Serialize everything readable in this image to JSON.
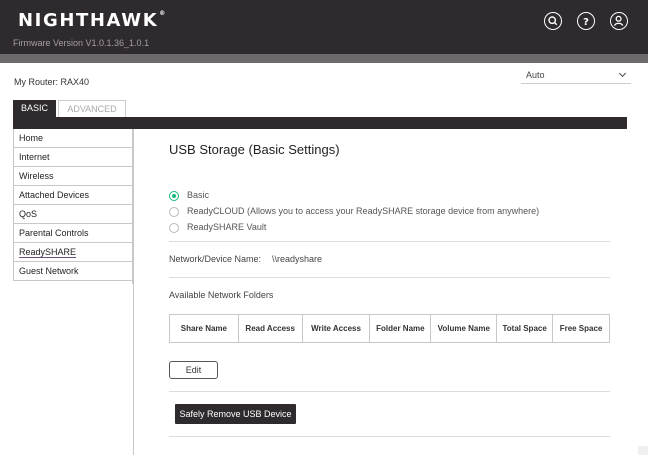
{
  "header": {
    "brand": "NIGHTHAWK",
    "trademark": "®",
    "firmware": "Firmware Version V1.0.1.36_1.0.1",
    "icons": [
      "search-icon",
      "help-icon",
      "user-icon"
    ]
  },
  "router": {
    "label": "My Router: RAX40",
    "language_value": "Auto"
  },
  "tabs": [
    {
      "label": "BASIC",
      "active": true
    },
    {
      "label": "ADVANCED",
      "active": false
    }
  ],
  "sidebar": {
    "items": [
      {
        "label": "Home"
      },
      {
        "label": "Internet"
      },
      {
        "label": "Wireless"
      },
      {
        "label": "Attached Devices"
      },
      {
        "label": "QoS"
      },
      {
        "label": "Parental Controls"
      },
      {
        "label": "ReadySHARE",
        "active": true
      },
      {
        "label": "Guest Network"
      }
    ]
  },
  "main": {
    "title": "USB Storage (Basic Settings)",
    "options": [
      {
        "label": "Basic",
        "selected": true
      },
      {
        "label": "ReadyCLOUD (Allows you to access your ReadySHARE storage device from anywhere)",
        "selected": false
      },
      {
        "label": "ReadySHARE Vault",
        "selected": false
      }
    ],
    "device_name_label": "Network/Device Name:",
    "device_name_value": "\\\\readyshare",
    "folders_label": "Available Network Folders",
    "table_headers": [
      "Share Name",
      "Read Access",
      "Write Access",
      "Folder Name",
      "Volume Name",
      "Total Space",
      "Free Space"
    ],
    "edit_label": "Edit",
    "remove_label": "Safely Remove USB Device"
  },
  "colors": {
    "header_bg": "#2f2a2d",
    "radio_selected": "#17b978",
    "active_underline": "#6a4f7f"
  }
}
